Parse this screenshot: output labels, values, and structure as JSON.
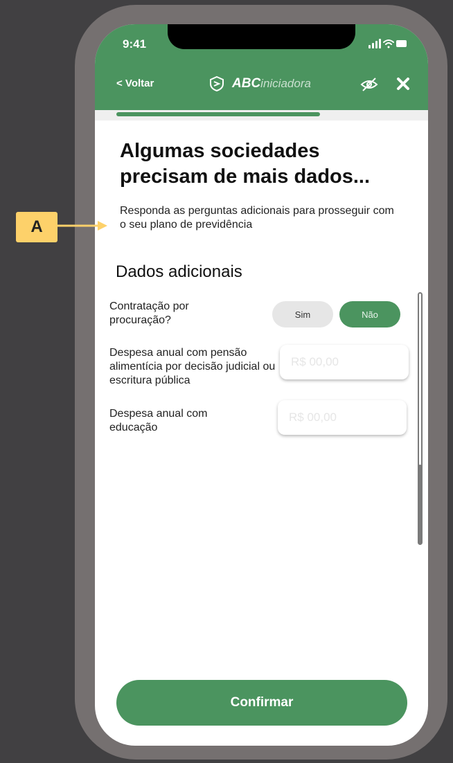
{
  "status_bar": {
    "time": "9:41"
  },
  "header": {
    "back_label": "< Voltar",
    "brand_bold": "ABC",
    "brand_light": "iniciadora",
    "icons": [
      "shield-logo-icon",
      "eye-off-icon",
      "close-icon"
    ]
  },
  "progress": {
    "fraction": 0.7
  },
  "content": {
    "title": "Algumas sociedades precisam de mais dados...",
    "subtitle": "Responda as perguntas adicionais para prosseguir com o seu plano de previdência",
    "section_title": "Dados adicionais"
  },
  "fields": [
    {
      "label": "Contratação por procuração?",
      "options": [
        "Sim",
        "Não"
      ],
      "selected": "Não"
    },
    {
      "label": "Despesa anual com pensão alimentícia por decisão judicial ou escritura pública",
      "placeholder": "R$ 00,00"
    },
    {
      "label": "Despesa anual com educação",
      "placeholder": "R$ 00,00"
    }
  ],
  "confirm_label": "Confirmar",
  "annotation": {
    "marker": "A"
  },
  "colors": {
    "primary_green": "#4b945f",
    "background": "#414042",
    "phone_frame": "#757070",
    "marker_yellow": "#fdd16a"
  }
}
